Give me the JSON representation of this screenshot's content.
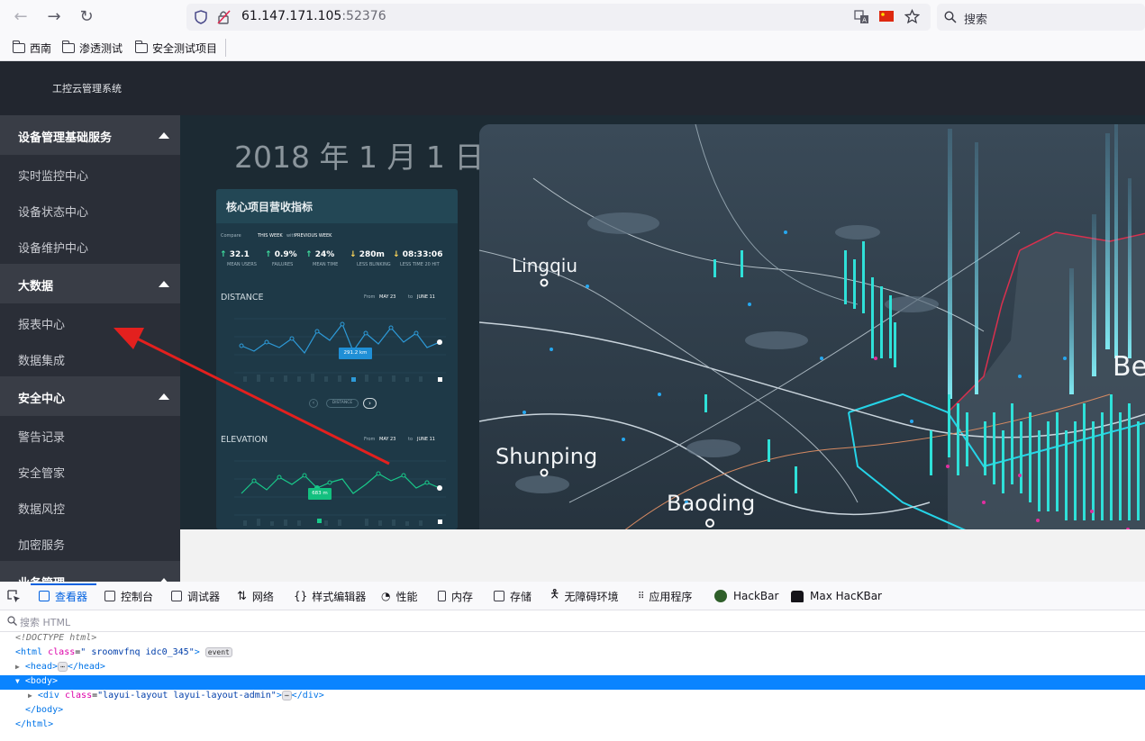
{
  "browser": {
    "url_host": "61.147.171.105",
    "url_port": ":52376",
    "search_placeholder": "搜索",
    "bookmarks": [
      "西南",
      "渗透测试",
      "安全测试项目"
    ]
  },
  "app": {
    "title": "工控云管理系统",
    "sidebar": [
      {
        "group": "设备管理基础服务",
        "items": [
          "实时监控中心",
          "设备状态中心",
          "设备维护中心"
        ]
      },
      {
        "group": "大数据",
        "items": [
          "报表中心",
          "数据集成"
        ]
      },
      {
        "group": "安全中心",
        "items": [
          "警告记录",
          "安全管家",
          "数据风控",
          "加密服务"
        ]
      },
      {
        "group": "业务管理",
        "items": []
      }
    ],
    "date_heading": "2018 年 1 月 1 日",
    "card": {
      "title": "核心项目营收指标",
      "compare": [
        "Compare",
        "THIS WEEK",
        "with",
        "PREVIOUS WEEK"
      ],
      "stats": [
        {
          "value": "32.1",
          "label": "MEAN USERS"
        },
        {
          "value": "0.9%",
          "label": "FAILURES"
        },
        {
          "value": "24%",
          "label": "MEAN TIME"
        },
        {
          "value": "280m",
          "label": "LESS BLINKING"
        },
        {
          "value": "08:33:06",
          "label": "LESS TIME 20 HIT"
        }
      ],
      "distance": {
        "label": "DISTANCE",
        "from": "From",
        "from_date": "MAY 23",
        "to": "to",
        "to_date": "JUNE 11",
        "badge": "291.2 km",
        "pager": "DISTANCE"
      },
      "elevation": {
        "label": "ELEVATION",
        "from": "From",
        "from_date": "MAY 23",
        "to": "to",
        "to_date": "JUNE 11",
        "badge": "683 m"
      }
    },
    "map_cities": [
      "Lingqiu",
      "Shunping",
      "Baoding",
      "Be"
    ]
  },
  "devtools": {
    "tabs": [
      "查看器",
      "控制台",
      "调试器",
      "网络",
      "样式编辑器",
      "性能",
      "内存",
      "存储",
      "无障碍环境",
      "应用程序",
      "HackBar",
      "Max HacKBar"
    ],
    "search_placeholder": "搜索 HTML",
    "lines": {
      "doctype": "<!DOCTYPE html>",
      "html_open": "<html",
      "html_attr": "class",
      "html_val": "\" sroomvfnq idc0_345\"",
      "event_badge": "event",
      "head": "<head>",
      "head_close": "</head>",
      "body_open": "<body>",
      "div_open": "<div",
      "div_attr": "class",
      "div_val": "\"layui-layout layui-layout-admin\"",
      "div_close": "</div>",
      "body_close": "</body>",
      "html_close": "</html>",
      "ellipsis": "⋯"
    }
  }
}
